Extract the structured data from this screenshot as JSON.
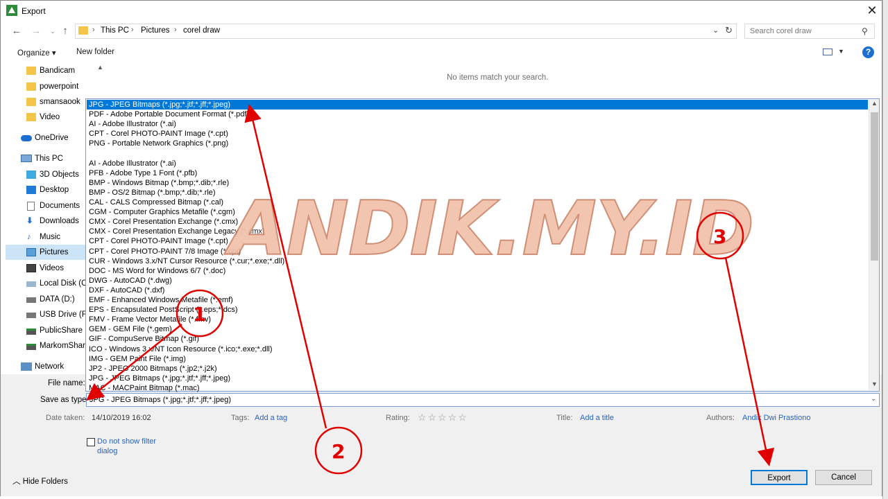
{
  "window": {
    "title": "Export"
  },
  "address": {
    "crumbs": [
      "This PC",
      "Pictures",
      "corel draw"
    ],
    "separators": [
      "›",
      "›",
      "›",
      "›"
    ]
  },
  "search": {
    "placeholder": "Search corel draw"
  },
  "commands": {
    "organize": "Organize ▾",
    "new_folder": "New folder"
  },
  "nav": {
    "items": [
      {
        "label": "Bandicam"
      },
      {
        "label": "powerpoint"
      },
      {
        "label": "smansaook"
      },
      {
        "label": "Video"
      },
      {
        "label": "OneDrive"
      },
      {
        "label": "This PC"
      },
      {
        "label": "3D Objects"
      },
      {
        "label": "Desktop"
      },
      {
        "label": "Documents"
      },
      {
        "label": "Downloads"
      },
      {
        "label": "Music"
      },
      {
        "label": "Pictures",
        "selected": true
      },
      {
        "label": "Videos"
      },
      {
        "label": "Local Disk (C:)"
      },
      {
        "label": "DATA (D:)"
      },
      {
        "label": "USB Drive (F:)"
      },
      {
        "label": "PublicShare (\\"
      },
      {
        "label": "MarkomShare"
      },
      {
        "label": "Network"
      }
    ]
  },
  "content": {
    "empty_message": "No items match your search."
  },
  "file_types": [
    "JPG - JPEG Bitmaps (*.jpg;*.jtf;*.jff;*.jpeg)",
    "PDF - Adobe Portable Document Format (*.pdf)",
    "AI - Adobe Illustrator (*.ai)",
    "CPT - Corel PHOTO-PAINT Image (*.cpt)",
    "PNG - Portable Network Graphics (*.png)",
    "",
    "AI - Adobe Illustrator (*.ai)",
    "PFB - Adobe Type 1 Font (*.pfb)",
    "BMP - Windows Bitmap (*.bmp;*.dib;*.rle)",
    "BMP - OS/2 Bitmap (*.bmp;*.dib;*.rle)",
    "CAL - CALS Compressed Bitmap (*.cal)",
    "CGM - Computer Graphics Metafile (*.cgm)",
    "CMX - Corel Presentation Exchange (*.cmx)",
    "CMX - Corel Presentation Exchange Legacy (*.cmx)",
    "CPT - Corel PHOTO-PAINT Image (*.cpt)",
    "CPT - Corel PHOTO-PAINT 7/8 Image (*.cpt)",
    "CUR - Windows 3.x/NT Cursor Resource (*.cur;*.exe;*.dll)",
    "DOC - MS Word for Windows 6/7 (*.doc)",
    "DWG - AutoCAD (*.dwg)",
    "DXF - AutoCAD (*.dxf)",
    "EMF - Enhanced Windows Metafile (*.emf)",
    "EPS - Encapsulated PostScript (*.eps;*.dcs)",
    "FMV - Frame Vector Metafile (*.fmv)",
    "GEM - GEM File (*.gem)",
    "GIF - CompuServe Bitmap (*.gif)",
    "ICO - Windows 3.x/NT Icon Resource (*.ico;*.exe;*.dll)",
    "IMG - GEM Paint File (*.img)",
    "JP2 - JPEG 2000 Bitmaps (*.jp2;*.j2k)",
    "JPG - JPEG Bitmaps (*.jpg;*.jtf;*.jff;*.jpeg)",
    "MAC - MACPaint Bitmap (*.mac)"
  ],
  "form": {
    "file_name_label": "File name:",
    "save_as_type_label": "Save as type:",
    "save_as_type_value": "JPG - JPEG Bitmaps (*.jpg;*.jtf;*.jff;*.jpeg)",
    "date_taken_label": "Date taken:",
    "date_taken_value": "14/10/2019 16:02",
    "tags_label": "Tags:",
    "tags_value": "Add a tag",
    "rating_label": "Rating:",
    "rating_stars": "☆☆☆☆☆",
    "title_label": "Title:",
    "title_value": "Add a title",
    "authors_label": "Authors:",
    "authors_value": "Andik Dwi Prastiono",
    "filter_checkbox_label": "Do not show filter dialog"
  },
  "footer": {
    "hide_folders": "Hide Folders",
    "export_button": "Export",
    "cancel_button": "Cancel"
  },
  "watermark": {
    "text": "ANDIK.MY.ID"
  },
  "annotations": {
    "step1": "1",
    "step2": "2",
    "step3": "3"
  },
  "colors": {
    "accent": "#0078d7",
    "annotation": "#e00000",
    "link": "#2a62b8"
  }
}
